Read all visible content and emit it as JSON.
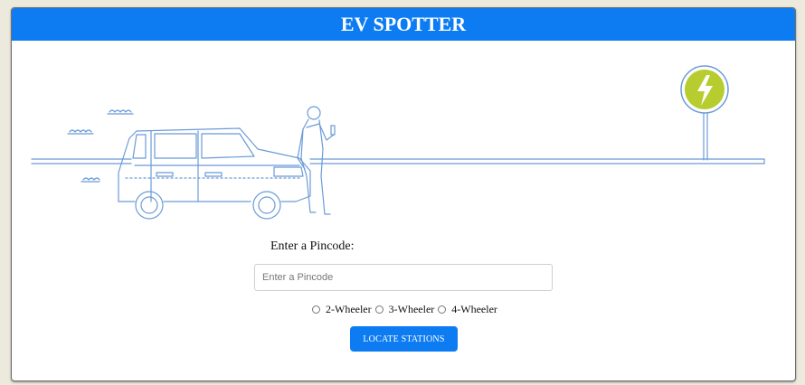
{
  "header": {
    "title": "EV SPOTTER"
  },
  "form": {
    "pincode_label": "Enter a Pincode:",
    "pincode_placeholder": "Enter a Pincode",
    "pincode_value": "",
    "vehicle_types": [
      {
        "label": "2-Wheeler",
        "checked": false
      },
      {
        "label": "3-Wheeler",
        "checked": false
      },
      {
        "label": "4-Wheeler",
        "checked": false
      }
    ],
    "submit_label": "LOCATE STATIONS"
  },
  "colors": {
    "brand_blue": "#0d7cf2",
    "illustration_line": "#6a9bd8",
    "bolt_sign": "#b7cc2e"
  },
  "illustration": {
    "icons": [
      "car-illustration",
      "person-illustration",
      "charging-sign-icon",
      "lightning-bolt-icon"
    ]
  }
}
